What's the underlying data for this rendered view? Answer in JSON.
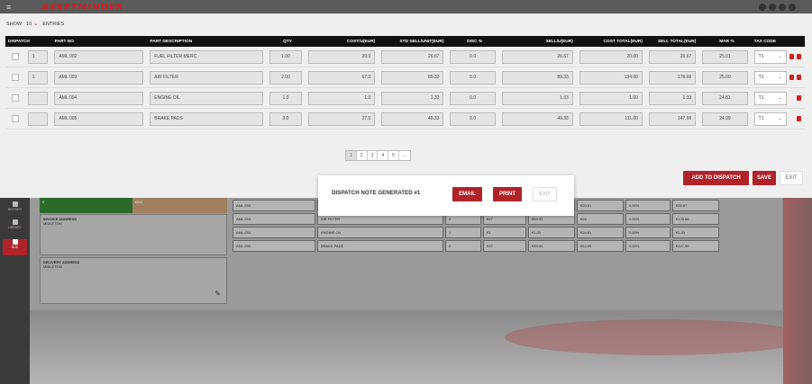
{
  "app": {
    "logo_text": "ASSETMINDER",
    "sidebar": [
      {
        "label": "HISTORY"
      },
      {
        "label": "LIBRARY"
      },
      {
        "label": "BOE"
      }
    ]
  },
  "background": {
    "green_label": "0",
    "orange_label": "£0.0",
    "invoice_address_label": "INVOICE ADDRESS",
    "invoice_address_value": "MIDLETON",
    "delivery_address_label": "DELIVERY ADDRESS",
    "delivery_address_value": "MIDLETON",
    "rows": [
      {
        "part": "AML-005",
        "desc": "",
        "qty": "",
        "a": "",
        "b": "€26.67",
        "c": "€20.01",
        "d": "0.00%",
        "e": "€26.67"
      },
      {
        "part": "AML-003",
        "desc": "AIR FILTER",
        "qty": "2",
        "a": "€67",
        "b": "€89.33",
        "c": "€26",
        "d": "0.00%",
        "e": "€178.66"
      },
      {
        "part": "AML-004",
        "desc": "ENGINE OIL",
        "qty": "1",
        "a": "€1",
        "b": "€1.33",
        "c": "€24.81",
        "d": "0.00%",
        "e": "€1.33"
      },
      {
        "part": "AML-005",
        "desc": "BRAKE PADS",
        "qty": "2",
        "a": "€37",
        "b": "€49.33",
        "c": "€24.99",
        "d": "0.00%",
        "e": "€147.99"
      }
    ]
  },
  "dialog": {
    "show_label": "SHOW",
    "entries_value": "10",
    "entries_label": "ENTRIES",
    "columns": [
      "DISPATCH",
      "PART NO",
      "PART DESCRIPTION",
      "QTY",
      "COST/U(EUR)",
      "STD SELL/UNIT(EUR)",
      "DISC %",
      "SELL/U(EUR)",
      "COST TOTAL(EUR)",
      "SELL TOTAL(EUR)",
      "MAR %",
      "TAX CODE"
    ],
    "rows": [
      {
        "dispatch_qty": "1",
        "part_no": "AML 002",
        "desc": "FUEL FILTER MERC",
        "qty": "1.00",
        "cost": "20.0",
        "std_sell": "26.67",
        "disc": "0.0",
        "sell": "26.67",
        "cost_total": "20.00",
        "sell_total": "26.67",
        "mar": "25.01",
        "tax": "T1",
        "show_extra_icon": true
      },
      {
        "dispatch_qty": "1",
        "part_no": "AML 003",
        "desc": "AIR FILTER",
        "qty": "2.00",
        "cost": "67.0",
        "std_sell": "89.33",
        "disc": "0.0",
        "sell": "89.33",
        "cost_total": "134.00",
        "sell_total": "178.66",
        "mar": "25.00",
        "tax": "T1",
        "show_extra_icon": true
      },
      {
        "dispatch_qty": "",
        "part_no": "AML 004",
        "desc": "ENGINE OIL",
        "qty": "1.0",
        "cost": "1.0",
        "std_sell": "1.33",
        "disc": "0.0",
        "sell": "1.33",
        "cost_total": "1.00",
        "sell_total": "1.33",
        "mar": "24.81",
        "tax": "T1",
        "show_extra_icon": false
      },
      {
        "dispatch_qty": "",
        "part_no": "AML 005",
        "desc": "BRAKE PADS",
        "qty": "3.0",
        "cost": "37.0",
        "std_sell": "49.33",
        "disc": "0.0",
        "sell": "49.33",
        "cost_total": "111.00",
        "sell_total": "147.99",
        "mar": "24.99",
        "tax": "T1",
        "show_extra_icon": false
      }
    ],
    "pagination": [
      "1",
      "2",
      "3",
      "4",
      "5",
      "..."
    ],
    "active_page": "1",
    "add_to_dispatch_label": "ADD TO DISPATCH",
    "save_label": "SAVE",
    "exit_label": "EXIT"
  },
  "modal": {
    "title": "DISPATCH NOTE GENERATED #1",
    "email_label": "EMAIL",
    "print_label": "PRINT",
    "exit_label": "EXIT"
  },
  "colors": {
    "accent": "#b0232a",
    "header_bg": "#111111",
    "dialog_bg": "#efefef"
  }
}
